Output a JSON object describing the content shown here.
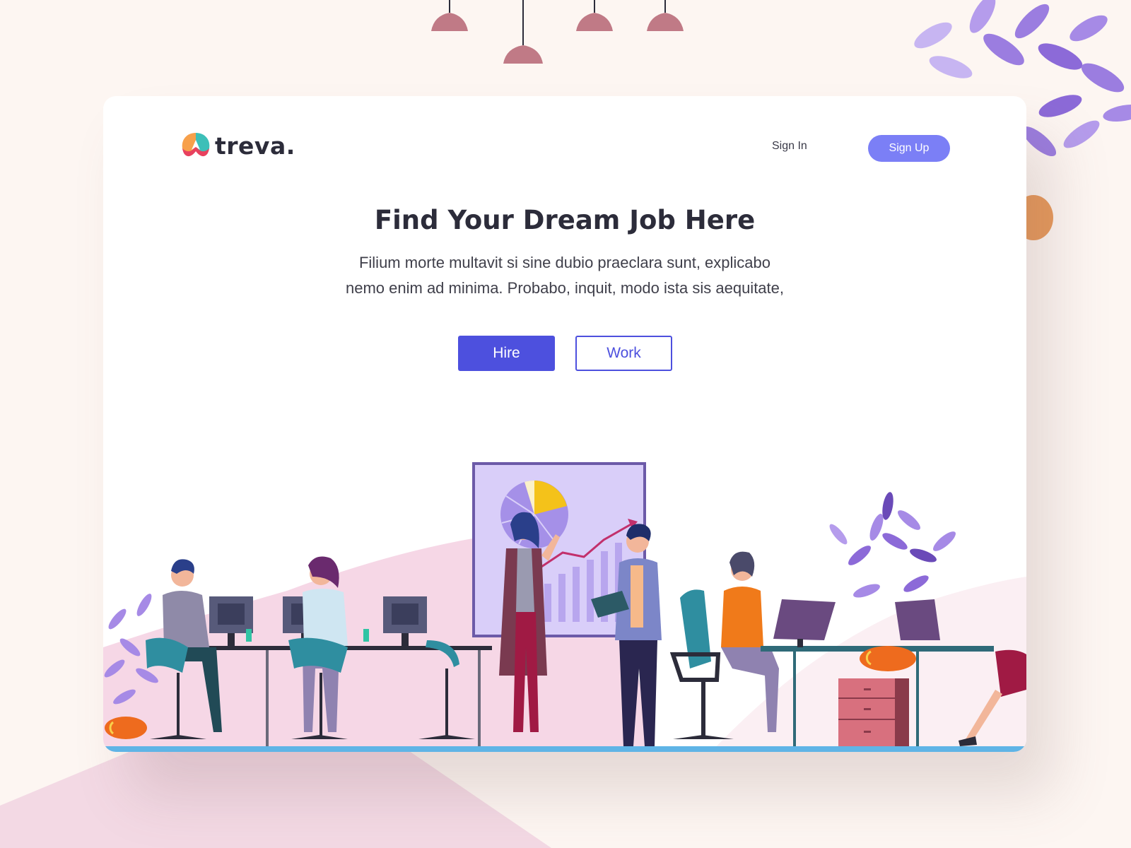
{
  "brand": {
    "name": "treva."
  },
  "nav": {
    "signin_label": "Sign In",
    "signup_label": "Sign Up"
  },
  "hero": {
    "title": "Find Your Dream Job Here",
    "subtitle_line1": "Filium morte multavit si sine dubio praeclara sunt, explicabo",
    "subtitle_line2": "nemo enim ad minima. Probabo, inquit, modo ista sis aequitate,"
  },
  "actions": {
    "hire_label": "Hire",
    "work_label": "Work"
  },
  "colors": {
    "primary": "#4d50de",
    "signup": "#7b7ff6",
    "background": "#fdf6f2",
    "text_dark": "#2c2c3a"
  }
}
